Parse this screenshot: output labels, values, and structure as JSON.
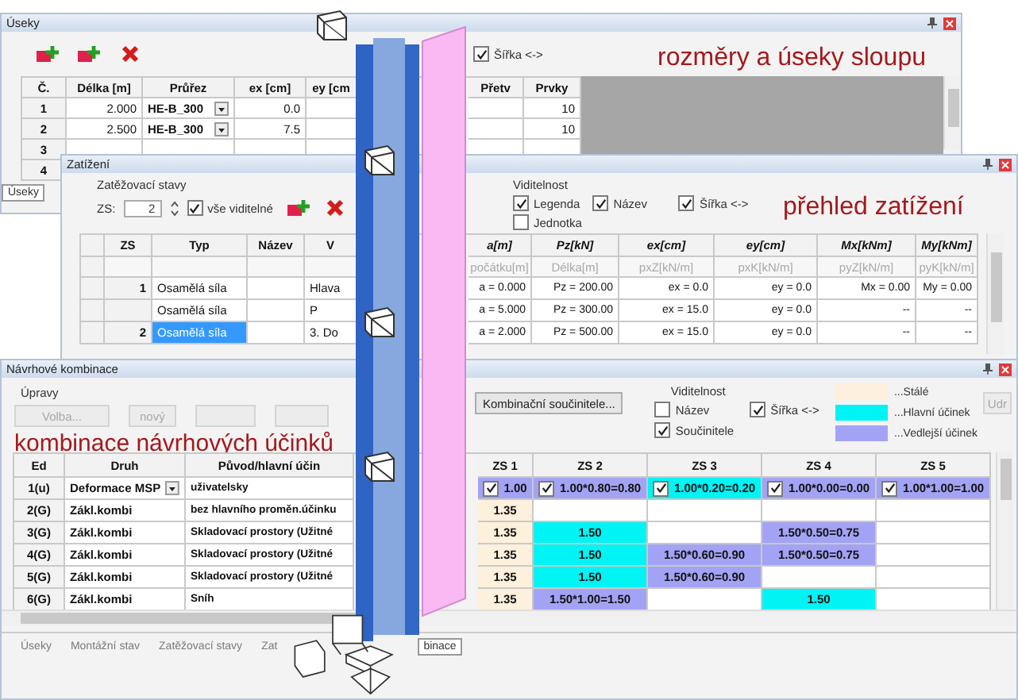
{
  "segments": {
    "title": "Úseky",
    "width_toggle": {
      "label": "Šířka <->",
      "checked": true
    },
    "caption": "rozměry a úseky sloupu",
    "columns": [
      "Č.",
      "Délka [m]",
      "Průřez",
      "ex [cm]",
      "ey [cm",
      "Přetv",
      "Prvky"
    ],
    "rows": [
      {
        "number": "1",
        "length": "2.000",
        "section": "HE-B_300",
        "ex": "0.0",
        "elements": "10"
      },
      {
        "number": "2",
        "length": "2.500",
        "section": "HE-B_300",
        "ex": "7.5",
        "elements": "10"
      },
      {
        "number": "3"
      },
      {
        "number": "4"
      }
    ],
    "tab": "Úseky"
  },
  "loads": {
    "title": "Zatížení",
    "group_label": "Zatěžovací stavy",
    "zs_label": "ZS:",
    "zs_value": "2",
    "all_visible": {
      "label": "vše viditelné",
      "checked": true
    },
    "visibility": {
      "label": "Viditelnost",
      "options": [
        {
          "label": "Legenda",
          "checked": true
        },
        {
          "label": "Název",
          "checked": true
        },
        {
          "label": "Šířka <->",
          "checked": true
        },
        {
          "label": "Jednotka",
          "checked": false
        }
      ]
    },
    "caption": "přehled zatížení",
    "columns": [
      {
        "label": "ZS"
      },
      {
        "label": "Typ"
      },
      {
        "label": "Název"
      },
      {
        "label": "V"
      },
      {
        "label": "a[m]",
        "unit": "počátku[m]"
      },
      {
        "label": "Pz[kN]",
        "unit": "Délka[m]"
      },
      {
        "label": "ex[cm]",
        "unit": "pxZ[kN/m]"
      },
      {
        "label": "ey[cm]",
        "unit": "pxK[kN/m]"
      },
      {
        "label": "Mx[kNm]",
        "unit": "pyZ[kN/m]"
      },
      {
        "label": "My[kNm]",
        "unit": "pyK[kN/m]"
      }
    ],
    "rows": [
      {
        "zs": "1",
        "type": "Osamělá síla",
        "ref": "Hlava",
        "values": [
          "a = 0.000",
          "Pz = 200.00",
          "ex = 0.0",
          "ey = 0.0",
          "Mx = 0.00",
          "My = 0.00"
        ],
        "selected": false
      },
      {
        "type": "Osamělá síla",
        "ref": "P",
        "values": [
          "a = 5.000",
          "Pz = 300.00",
          "ex = 15.0",
          "ey = 0.0",
          "--",
          "--"
        ],
        "selected": false
      },
      {
        "zs": "2",
        "type": "Osamělá síla",
        "ref": "3. Do",
        "values": [
          "a = 2.000",
          "Pz = 500.00",
          "ex = 15.0",
          "ey = 0.0",
          "--",
          "--"
        ],
        "selected": true
      }
    ]
  },
  "combinations": {
    "title": "Návrhové kombinace",
    "edits_label": "Úpravy",
    "edit_buttons": [
      {
        "label": "Volba...",
        "disabled": true
      },
      {
        "label": "nový",
        "disabled": true
      }
    ],
    "factors_button": "Kombinační součinitele...",
    "visibility": {
      "label": "Viditelnost",
      "options": [
        {
          "label": "Název",
          "checked": false
        },
        {
          "label": "Součinitele",
          "checked": true
        },
        {
          "label": "Šířka <->",
          "checked": true
        }
      ]
    },
    "legend": [
      {
        "label": "...Stálé",
        "color": "#fdf0dc"
      },
      {
        "label": "...Hlavní účinek",
        "color": "#00f4f4"
      },
      {
        "label": "...Vedlejší účinek",
        "color": "#a3a3f5"
      }
    ],
    "side_button": {
      "label": "Udr",
      "disabled": true
    },
    "caption": "kombinace návrhových účinků",
    "columns": [
      "Ed",
      "Druh",
      "Původ/hlavní účin",
      "ZS 1",
      "ZS 2",
      "ZS 3",
      "ZS 4",
      "ZS 5"
    ],
    "rows": [
      {
        "ed": "1(u)",
        "type": "Deformace MSP",
        "dropdown": true,
        "origin": "uživatelsky",
        "factors": [
          {
            "text": "1.00",
            "checked": true,
            "kind": "accompanying"
          },
          {
            "text": "1.00*0.80=0.80",
            "checked": true,
            "kind": "accompanying"
          },
          {
            "text": "1.00*0.20=0.20",
            "checked": true,
            "kind": "leading"
          },
          {
            "text": "1.00*0.00=0.00",
            "checked": true,
            "kind": "accompanying"
          },
          {
            "text": "1.00*1.00=1.00",
            "checked": true,
            "kind": "accompanying"
          }
        ]
      },
      {
        "ed": "2(G)",
        "type": "Zákl.kombi",
        "dropdown": false,
        "origin": "bez hlavního proměn.účinku",
        "factors": [
          {
            "text": "1.35",
            "checked": false,
            "kind": "permanent"
          },
          {
            "kind": "empty"
          },
          {
            "kind": "empty"
          },
          {
            "kind": "empty"
          },
          {
            "kind": "empty"
          }
        ]
      },
      {
        "ed": "3(G)",
        "type": "Zákl.kombi",
        "dropdown": false,
        "origin": "Skladovací prostory (Užitné",
        "factors": [
          {
            "text": "1.35",
            "checked": false,
            "kind": "permanent"
          },
          {
            "text": "1.50",
            "checked": false,
            "kind": "leading"
          },
          {
            "kind": "empty"
          },
          {
            "text": "1.50*0.50=0.75",
            "checked": false,
            "kind": "accompanying"
          },
          {
            "kind": "empty"
          }
        ]
      },
      {
        "ed": "4(G)",
        "type": "Zákl.kombi",
        "dropdown": false,
        "origin": "Skladovací prostory (Užitné",
        "factors": [
          {
            "text": "1.35",
            "checked": false,
            "kind": "permanent"
          },
          {
            "text": "1.50",
            "checked": false,
            "kind": "leading"
          },
          {
            "text": "1.50*0.60=0.90",
            "checked": false,
            "kind": "accompanying"
          },
          {
            "text": "1.50*0.50=0.75",
            "checked": false,
            "kind": "accompanying"
          },
          {
            "kind": "empty"
          }
        ]
      },
      {
        "ed": "5(G)",
        "type": "Zákl.kombi",
        "dropdown": false,
        "origin": "Skladovací prostory (Užitné",
        "factors": [
          {
            "text": "1.35",
            "checked": false,
            "kind": "permanent"
          },
          {
            "text": "1.50",
            "checked": false,
            "kind": "leading"
          },
          {
            "text": "1.50*0.60=0.90",
            "checked": false,
            "kind": "accompanying"
          },
          {
            "kind": "empty"
          },
          {
            "kind": "empty"
          }
        ]
      },
      {
        "ed": "6(G)",
        "type": "Zákl.kombi",
        "dropdown": false,
        "origin": "Sníh",
        "factors": [
          {
            "text": "1.35",
            "checked": false,
            "kind": "permanent"
          },
          {
            "text": "1.50*1.00=1.50",
            "checked": false,
            "kind": "accompanying"
          },
          {
            "kind": "empty"
          },
          {
            "text": "1.50",
            "checked": false,
            "kind": "leading"
          },
          {
            "kind": "empty"
          }
        ]
      }
    ],
    "tabs": [
      {
        "label": "Úseky",
        "selected": false
      },
      {
        "label": "Montážní stav",
        "selected": false
      },
      {
        "label": "Zatěžovací stavy",
        "selected": false
      },
      {
        "label": "Zat",
        "selected": false
      },
      {
        "label": "binace",
        "selected": true
      }
    ]
  }
}
